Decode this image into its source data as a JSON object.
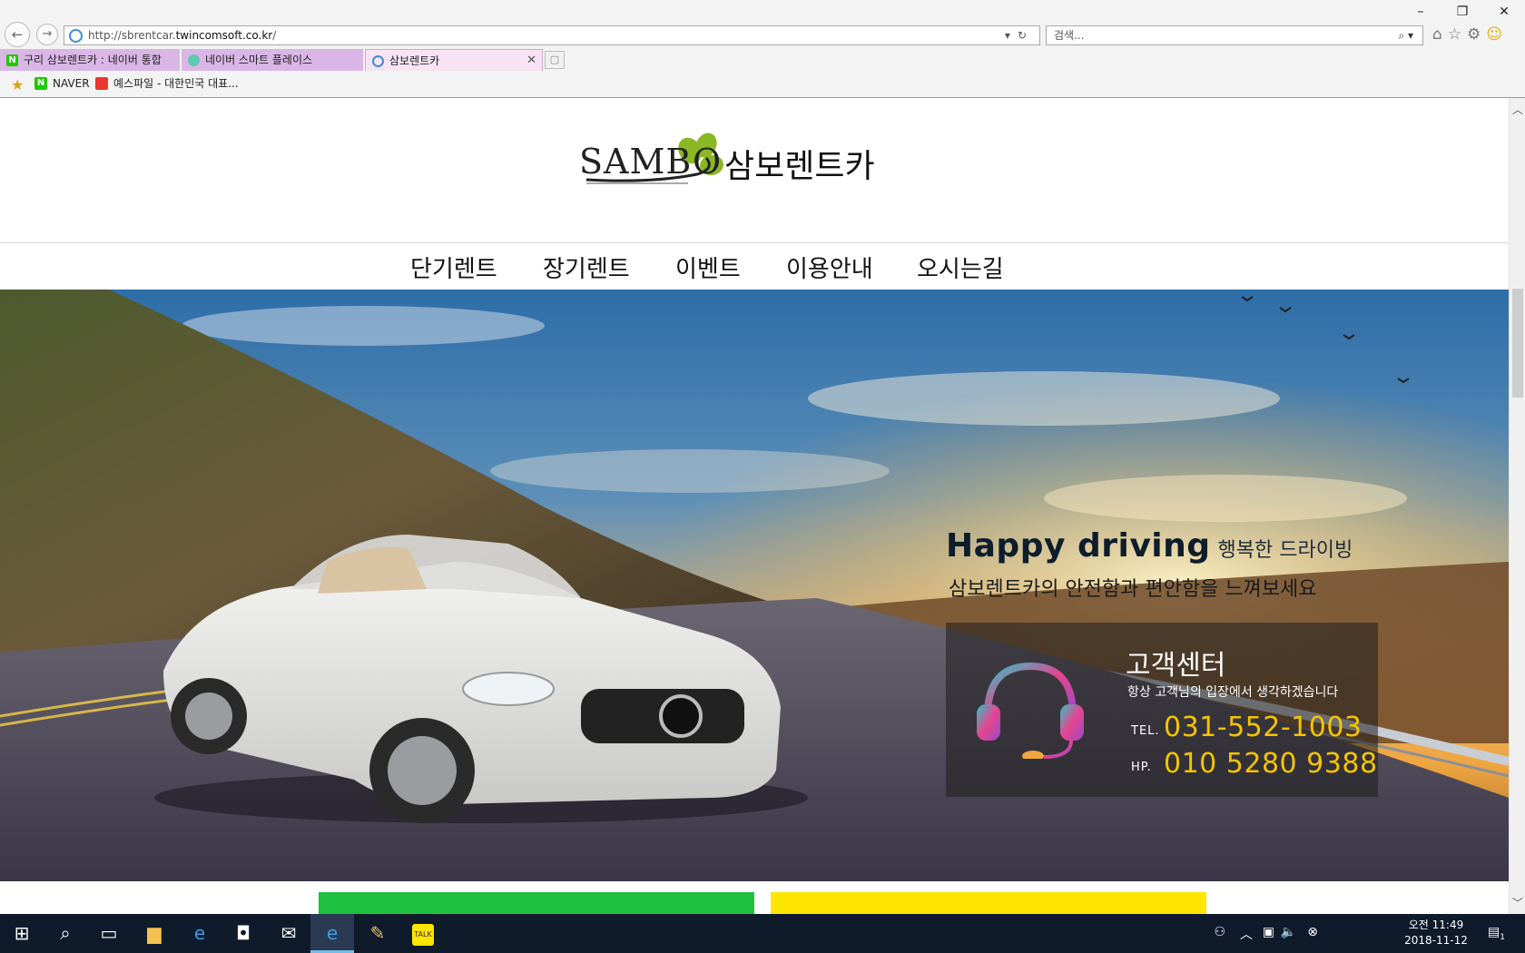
{
  "browser": {
    "url_prefix": "http://sbrentcar.",
    "url_domain": "twincomsoft.co.kr",
    "url_suffix": "/",
    "search_placeholder": "검색...",
    "window_controls": [
      "–",
      "❐",
      "✕"
    ],
    "tabs": [
      {
        "label": "구리 삼보렌트카 : 네이버 통합",
        "icon": "naver-icon",
        "active": false
      },
      {
        "label": "네이버 스마트 플레이스",
        "icon": "smartplace-icon",
        "active": false
      },
      {
        "label": "삼보렌트카",
        "icon": "ie-page-icon",
        "active": true
      }
    ],
    "favorites": [
      {
        "label": "NAVER",
        "icon": "naver-icon"
      },
      {
        "label": "예스파일 - 대한민국 대표...",
        "icon": "yesfile-icon"
      }
    ]
  },
  "site": {
    "logo_en": "SAMBO",
    "logo_ko": "삼보렌트카",
    "menu": [
      "단기렌트",
      "장기렌트",
      "이벤트",
      "이용안내",
      "오시는길"
    ],
    "hero": {
      "tagline_en": "Happy driving",
      "tagline_ko": "행복한 드라이빙",
      "subtagline": "삼보렌트카의 안전함과 편안함을 느껴보세요"
    },
    "customer_center": {
      "title": "고객센터",
      "desc": "항상 고객님의 입장에서 생각하겠습니다",
      "tel_label": "TEL.",
      "tel": "031-552-1003",
      "hp_label": "HP.",
      "hp": "010 5280 9388"
    },
    "colors": {
      "card_left": "#1ec040",
      "card_right": "#ffe600",
      "phone": "#f5c400"
    }
  },
  "taskbar": {
    "time_period": "오전 11:49",
    "date": "2018-11-12",
    "notification_count": "1"
  }
}
